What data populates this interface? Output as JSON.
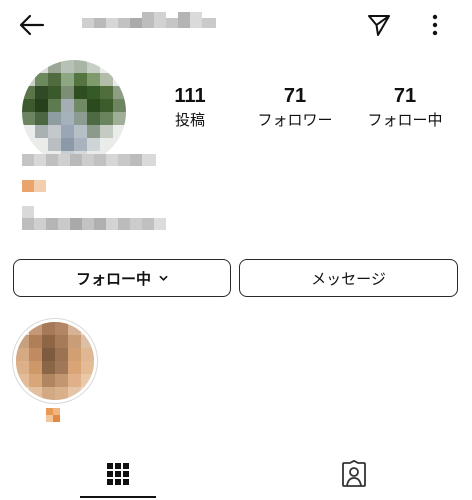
{
  "header": {
    "back_icon": "arrow-left-icon",
    "send_icon": "paper-plane-icon",
    "more_icon": "more-vertical-icon"
  },
  "stats": [
    {
      "value": "111",
      "label": "投稿"
    },
    {
      "value": "71",
      "label": "フォロワー"
    },
    {
      "value": "71",
      "label": "フォロー中"
    }
  ],
  "actions": {
    "follow_label": "フォロー中",
    "message_label": "メッセージ"
  },
  "tabs": {
    "grid_icon": "grid-icon",
    "tagged_icon": "tagged-person-icon"
  },
  "colors": {
    "text": "#111111",
    "border": "#2a2a2a",
    "blur_gray": "#c8c8c8",
    "accent_orange": "#e8a46a"
  }
}
